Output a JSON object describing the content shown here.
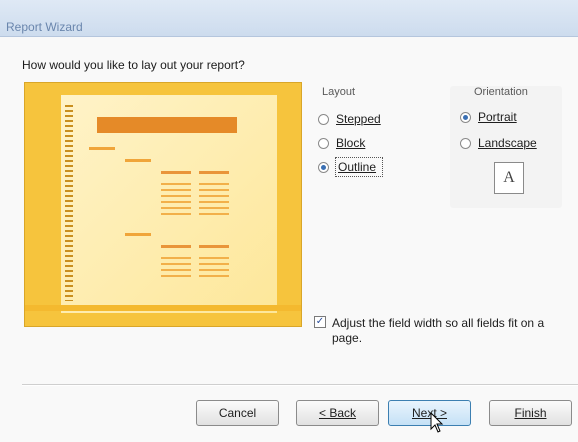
{
  "window": {
    "title": "Report Wizard"
  },
  "question": "How would you like to lay out your report?",
  "layout": {
    "label": "Layout",
    "options": [
      {
        "label": "Stepped",
        "selected": false
      },
      {
        "label": "Block",
        "selected": false
      },
      {
        "label": "Outline",
        "selected": true
      }
    ]
  },
  "orientation": {
    "label": "Orientation",
    "options": [
      {
        "label": "Portrait",
        "selected": true
      },
      {
        "label": "Landscape",
        "selected": false
      }
    ],
    "icon_letter": "A"
  },
  "adjust_width": {
    "label": "Adjust the field width so all fields fit on a page.",
    "checked": true
  },
  "buttons": {
    "cancel": "Cancel",
    "back": "< Back",
    "next": "Next >",
    "finish": "Finish"
  },
  "colors": {
    "preview_bg": "#f6c43d",
    "preview_header": "#e58a28",
    "title_text": "#6a86ad",
    "radio_dot": "#3a6fb3"
  }
}
